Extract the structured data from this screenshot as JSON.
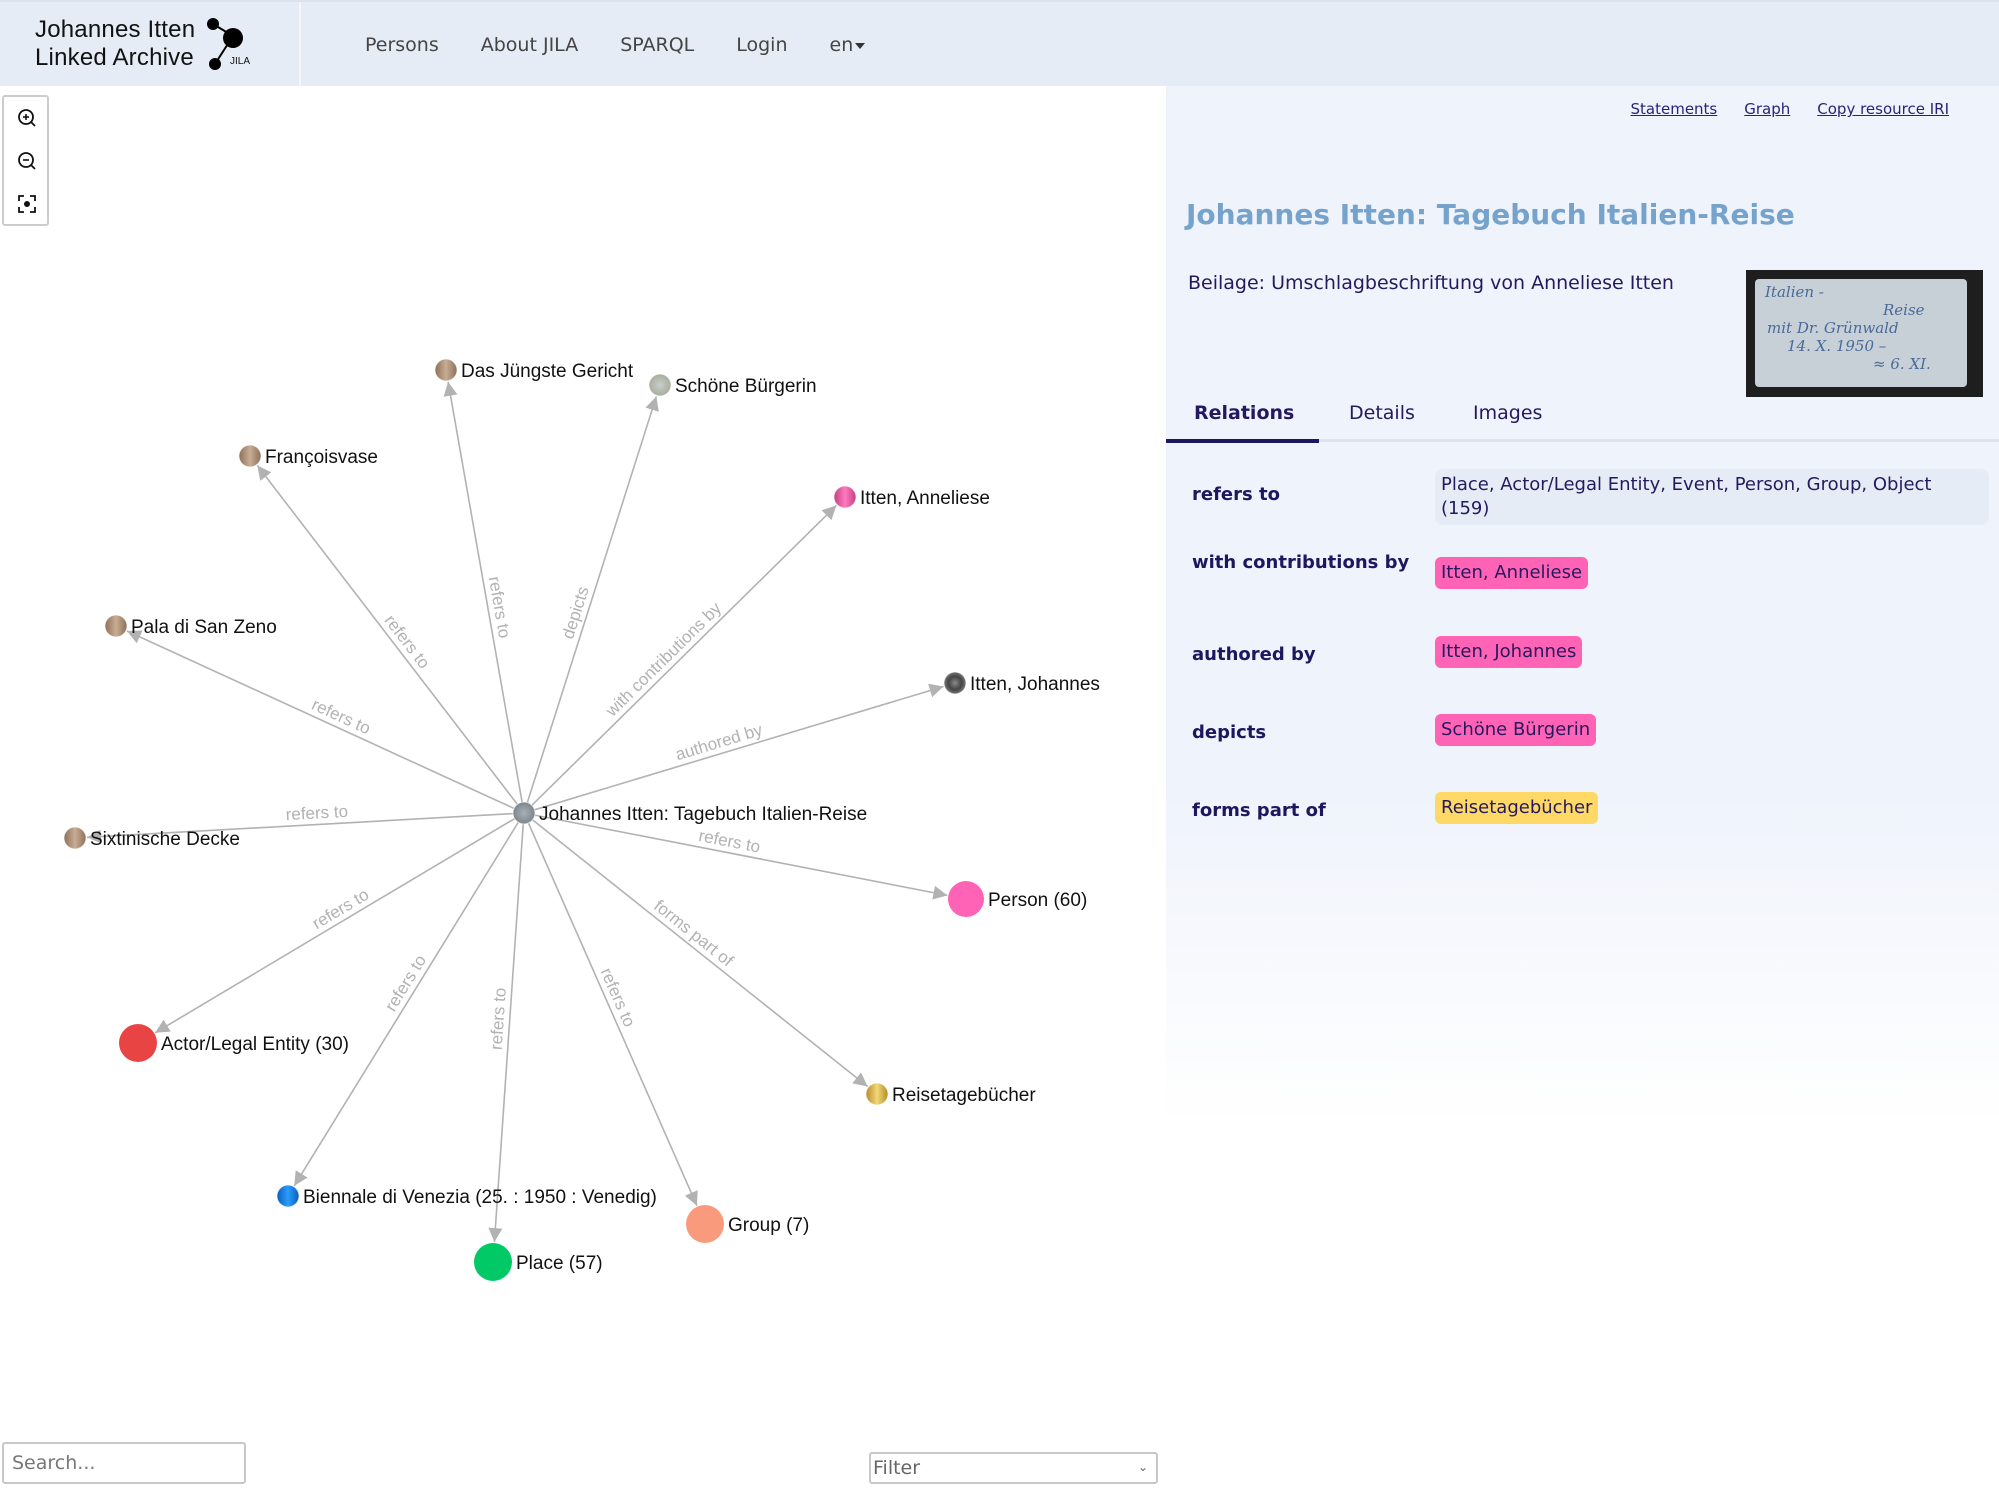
{
  "header": {
    "logo": {
      "line1": "Johannes Itten",
      "line2": "Linked Archive",
      "badge": "JILA"
    },
    "nav": [
      {
        "label": "Persons"
      },
      {
        "label": "About JILA"
      },
      {
        "label": "SPARQL"
      },
      {
        "label": "Login"
      },
      {
        "label": "en",
        "dropdown": true
      }
    ]
  },
  "graph": {
    "controls": [
      {
        "name": "zoom-in-icon"
      },
      {
        "name": "zoom-out-icon"
      },
      {
        "name": "fit-view-icon"
      }
    ],
    "center": {
      "id": "center",
      "label": "Johannes Itten: Tagebuch Italien-Reise",
      "style": "thumbnail-gray"
    },
    "nodes": [
      {
        "id": "n1",
        "label": "Das Jüngste Gericht",
        "edge": "refers to",
        "style": "artwork-brown"
      },
      {
        "id": "n2",
        "label": "Schöne Bürgerin",
        "edge": "depicts",
        "style": "thumbnail-light"
      },
      {
        "id": "n3",
        "label": "Françoisvase",
        "edge": "refers to",
        "style": "artwork-brown"
      },
      {
        "id": "n4",
        "label": "Itten, Anneliese",
        "edge": "with contributions by",
        "style": "person-pink"
      },
      {
        "id": "n5",
        "label": "Pala di San Zeno",
        "edge": "refers to",
        "style": "artwork-brown"
      },
      {
        "id": "n6",
        "label": "Itten, Johannes",
        "edge": "authored by",
        "style": "photo"
      },
      {
        "id": "n7",
        "label": "Sixtinische Decke",
        "edge": "refers to",
        "style": "artwork-brown"
      },
      {
        "id": "n8",
        "label": "Person (60)",
        "edge": "refers to",
        "style": "group",
        "color": "#ff63b5"
      },
      {
        "id": "n9",
        "label": "Actor/Legal Entity (30)",
        "edge": "refers to",
        "style": "group",
        "color": "#e84444"
      },
      {
        "id": "n10",
        "label": "Reisetagebücher",
        "edge": "forms part of",
        "style": "collection-gold"
      },
      {
        "id": "n11",
        "label": "Biennale di Venezia (25. : 1950 : Venedig)",
        "edge": "refers to",
        "style": "event-blue"
      },
      {
        "id": "n12",
        "label": "Group (7)",
        "edge": "refers to",
        "style": "group",
        "color": "#f99a7c"
      },
      {
        "id": "n13",
        "label": "Place (57)",
        "edge": "refers to",
        "style": "group",
        "color": "#00c965"
      }
    ],
    "search_placeholder": "Search...",
    "filter": {
      "selected": "Filter"
    }
  },
  "panel": {
    "links": [
      {
        "label": "Statements"
      },
      {
        "label": "Graph"
      },
      {
        "label": "Copy resource IRI"
      }
    ],
    "title": "Johannes Itten: Tagebuch Italien-Reise",
    "description": "Beilage: Umschlagbeschriftung von Anneliese Itten",
    "thumbnail_text": [
      "Italien -",
      "Reise",
      "mit Dr. Grünwald",
      "14. X. 1950 –",
      "≈ 6. XI."
    ],
    "tabs": [
      {
        "label": "Relations",
        "active": true
      },
      {
        "label": "Details",
        "active": false
      },
      {
        "label": "Images",
        "active": false
      }
    ],
    "relations": [
      {
        "label": "refers to",
        "summary": "Place, Actor/Legal Entity, Event, Person, Group, Object (159)"
      },
      {
        "label": "with contributions by",
        "chips": [
          {
            "text": "Itten, Anneliese",
            "color": "#ff63b5"
          }
        ]
      },
      {
        "label": "authored by",
        "chips": [
          {
            "text": "Itten, Johannes",
            "color": "#ff63b5"
          }
        ]
      },
      {
        "label": "depicts",
        "chips": [
          {
            "text": "Schöne Bürgerin",
            "color": "#ff63b5"
          }
        ]
      },
      {
        "label": "forms part of",
        "chips": [
          {
            "text": "Reisetagebücher",
            "color": "#ffd965"
          }
        ]
      }
    ]
  },
  "colors": {
    "header_bg": "#e6ecf5",
    "panel_bg": "#eff3fb",
    "title": "#76a3cc",
    "text_dark": "#24195e",
    "edge": "#b2b2b2",
    "accent": "#1f1660"
  }
}
